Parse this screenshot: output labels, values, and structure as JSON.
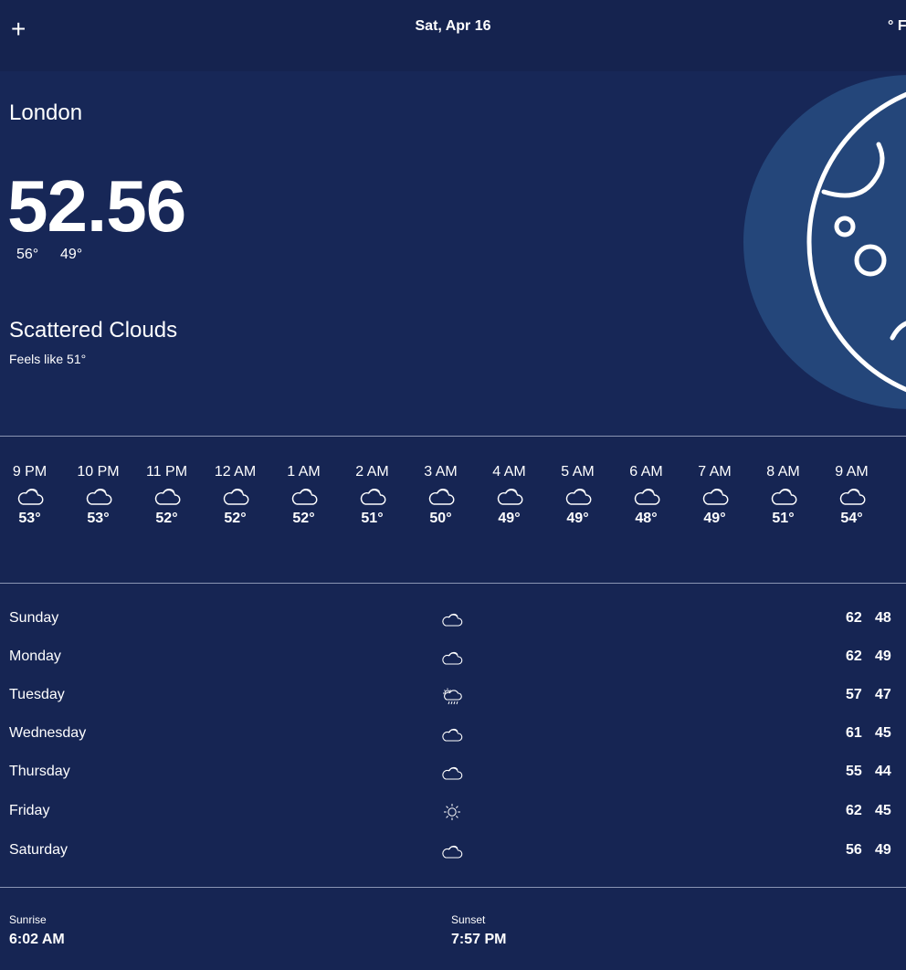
{
  "header": {
    "add_label": "+",
    "date": "Sat, Apr 16",
    "unit": "° F"
  },
  "current": {
    "city": "London",
    "temperature": "52.56",
    "high": "56°",
    "low": "49°",
    "condition": "Scattered Clouds",
    "feels_like_label": "Feels like",
    "feels_like_value": "51°",
    "icon": "moon-icon"
  },
  "hourly": [
    {
      "time": "9 PM",
      "icon": "cloud-icon",
      "temp": "53°"
    },
    {
      "time": "10 PM",
      "icon": "cloud-icon",
      "temp": "53°"
    },
    {
      "time": "11 PM",
      "icon": "cloud-icon",
      "temp": "52°"
    },
    {
      "time": "12 AM",
      "icon": "cloud-icon",
      "temp": "52°"
    },
    {
      "time": "1 AM",
      "icon": "cloud-icon",
      "temp": "52°"
    },
    {
      "time": "2 AM",
      "icon": "cloud-icon",
      "temp": "51°"
    },
    {
      "time": "3 AM",
      "icon": "cloud-icon",
      "temp": "50°"
    },
    {
      "time": "4 AM",
      "icon": "cloud-icon",
      "temp": "49°"
    },
    {
      "time": "5 AM",
      "icon": "cloud-icon",
      "temp": "49°"
    },
    {
      "time": "6 AM",
      "icon": "cloud-icon",
      "temp": "48°"
    },
    {
      "time": "7 AM",
      "icon": "cloud-icon",
      "temp": "49°"
    },
    {
      "time": "8 AM",
      "icon": "cloud-icon",
      "temp": "51°"
    },
    {
      "time": "9 AM",
      "icon": "cloud-icon",
      "temp": "54°"
    }
  ],
  "daily": [
    {
      "day": "Sunday",
      "icon": "cloud-icon",
      "high": "62",
      "low": "48"
    },
    {
      "day": "Monday",
      "icon": "cloud-icon",
      "high": "62",
      "low": "49"
    },
    {
      "day": "Tuesday",
      "icon": "rain-cloud-icon",
      "high": "57",
      "low": "47"
    },
    {
      "day": "Wednesday",
      "icon": "cloud-icon",
      "high": "61",
      "low": "45"
    },
    {
      "day": "Thursday",
      "icon": "cloud-icon",
      "high": "55",
      "low": "44"
    },
    {
      "day": "Friday",
      "icon": "sun-icon",
      "high": "62",
      "low": "45"
    },
    {
      "day": "Saturday",
      "icon": "cloud-icon",
      "high": "56",
      "low": "49"
    }
  ],
  "sun": {
    "sunrise_label": "Sunrise",
    "sunrise_time": "6:02 AM",
    "sunset_label": "Sunset",
    "sunset_time": "7:57 PM"
  },
  "colors": {
    "background": "#162553",
    "header": "#15234f",
    "moon_disc": "#24467a",
    "text": "#ffffff"
  }
}
